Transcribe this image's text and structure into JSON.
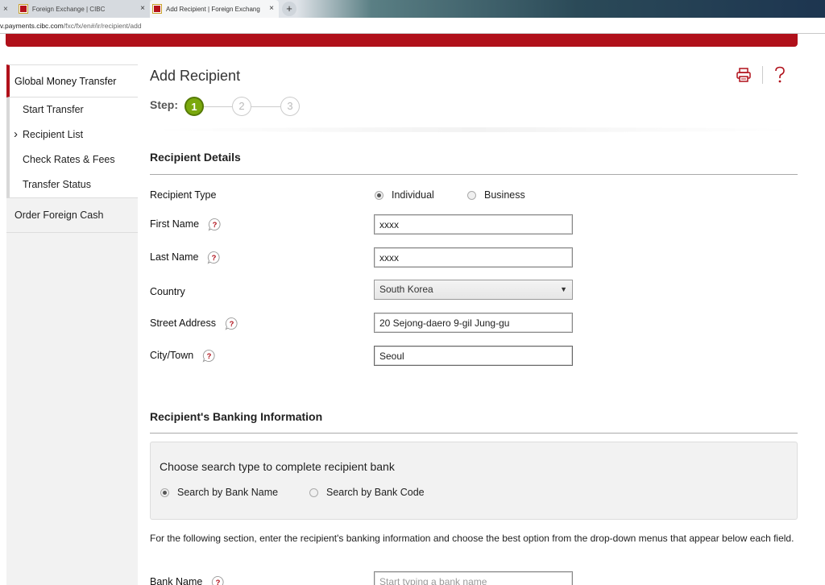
{
  "browser": {
    "tabs": [
      {
        "label": "Foreign Exchange | CIBC",
        "active": false
      },
      {
        "label": "Add Recipient | Foreign Exchang",
        "active": true
      }
    ],
    "url_host": "v.payments.cibc.com",
    "url_path": "/fxc/fx/en#/ir/recipient/add"
  },
  "sidebar": {
    "header": "Global Money Transfer",
    "items": [
      {
        "label": "Start Transfer"
      },
      {
        "label": "Recipient List"
      },
      {
        "label": "Check Rates & Fees"
      },
      {
        "label": "Transfer Status"
      }
    ],
    "order": "Order Foreign Cash"
  },
  "page": {
    "title": "Add Recipient",
    "step_label": "Step:",
    "steps": [
      "1",
      "2",
      "3"
    ],
    "current_step": 1
  },
  "recipient_details": {
    "title": "Recipient Details",
    "type_label": "Recipient Type",
    "type_options": [
      {
        "label": "Individual",
        "checked": true
      },
      {
        "label": "Business",
        "checked": false
      }
    ],
    "first_name_label": "First Name",
    "first_name_value": "xxxx",
    "last_name_label": "Last Name",
    "last_name_value": "xxxx",
    "country_label": "Country",
    "country_value": "South Korea",
    "street_label": "Street Address",
    "street_value": "20 Sejong-daero 9-gil Jung-gu",
    "city_label": "City/Town",
    "city_value": "Seoul"
  },
  "banking": {
    "title": "Recipient's Banking Information",
    "search_title": "Choose search type to complete recipient bank",
    "search_options": [
      {
        "label": "Search by Bank Name",
        "checked": true
      },
      {
        "label": "Search by Bank Code",
        "checked": false
      }
    ],
    "note": "For the following section, enter the recipient's banking information and choose the best option from the drop-down menus that appear below each field.",
    "bank_name_label": "Bank Name",
    "bank_name_placeholder": "Start typing a bank name"
  },
  "colors": {
    "brand_red": "#b0101a",
    "step_green": "#7aa80d"
  }
}
